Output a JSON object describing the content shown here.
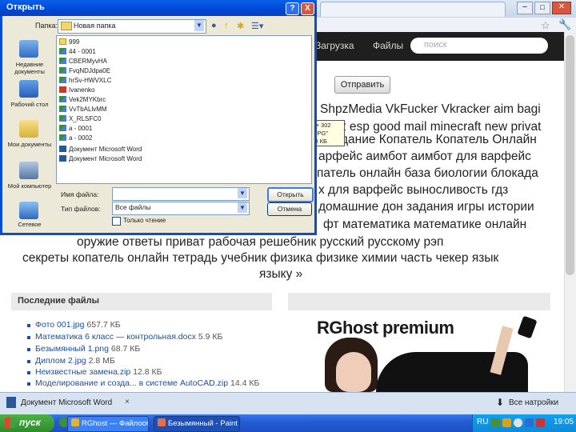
{
  "dialog": {
    "title": "Открыть",
    "look_in_label": "Папка:",
    "look_in_value": "Новая папка",
    "help_label": "?",
    "close_label": "X",
    "places": [
      {
        "label": "Недавние документы"
      },
      {
        "label": "Рабочий стол"
      },
      {
        "label": "Мои документы"
      },
      {
        "label": "Мой компьютер"
      },
      {
        "label": "Сетевое"
      }
    ],
    "files": [
      {
        "name": "999",
        "type": "folder"
      },
      {
        "name": "44 - 0001",
        "type": "image"
      },
      {
        "name": "CBERMyvHA",
        "type": "image"
      },
      {
        "name": "FvqNDJdpa0E",
        "type": "image"
      },
      {
        "name": "hrSv-HWVXLC",
        "type": "image"
      },
      {
        "name": "Ivanenko",
        "type": "pdf"
      },
      {
        "name": "Vek2MYKbrc",
        "type": "image"
      },
      {
        "name": "VvTbALlvMM",
        "type": "image"
      },
      {
        "name": "X_RLSFC0",
        "type": "image"
      },
      {
        "name": "а - 0001",
        "type": "image"
      },
      {
        "name": "а - 0002",
        "type": "image"
      },
      {
        "name": "Документ Microsoft Word",
        "type": "word"
      },
      {
        "name": "Документ Microsoft Word",
        "type": "word"
      }
    ],
    "file_name_label": "Имя файла:",
    "file_name_value": "",
    "file_type_label": "Тип файлов:",
    "file_type_value": "Все файлы",
    "read_only_label": "Только чтение",
    "open_button": "Открыть",
    "cancel_button": "Отмена"
  },
  "tooltip": {
    "line1": "Размеры: 4 × 302",
    "line2": "Тип: Файл \"JPG\"",
    "line3": "Размер: 45,3 КБ"
  },
  "site": {
    "nav_link_1": "Загрузка",
    "nav_link_2": "Файлы",
    "search_placeholder": "поиск",
    "send_button": "Отправить",
    "tagline_lines": [
      "ShpzMedia VkFucker Vkracker aim bagi",
      "2 esp good mail minecraft new privat",
      "дание Копатель Копатель Онлайн",
      "арфейс аимбот аимбот для варфейс",
      "патель онлайн база биологии блокада",
      "х для варфейс выносливость гдз",
      "домашние дон задания игры истории",
      "фт математика математике онлайн",
      "оружие ответы приват рабочая решебник русский русскому рэп",
      "секреты копатель онлайн тетрадь учебник физика физике химии часть чекер язык",
      "языку »"
    ],
    "recent_title": "Последние файлы",
    "recent_files": [
      {
        "name": "Фото 001.jpg",
        "size": "657.7 КБ"
      },
      {
        "name": "Математика 6 класс — контрольная.docx",
        "size": "5.9 КБ"
      },
      {
        "name": "Безымянный 1.png",
        "size": "68.7 КБ"
      },
      {
        "name": "Диплом 2.jpg",
        "size": "2.8 МБ"
      },
      {
        "name": "Неизвестные замена.zip",
        "size": "12.8 КБ"
      },
      {
        "name": "Моделирование и созда... в системе AutoCAD.zip",
        "size": "14.4 КБ"
      }
    ],
    "ad_title": "RGhost premium"
  },
  "app_bar": {
    "doc_label": "Документ Microsoft Word",
    "close_label": "×",
    "right_label": "Все натройки"
  },
  "taskbar": {
    "start_label": "пуск",
    "tasks": [
      {
        "label": "RGhost — Файлообмен..."
      },
      {
        "label": "Безымянный - Paint"
      }
    ],
    "lang": "RU",
    "clock": "19:05"
  },
  "colors": {
    "xp_blue": "#0048d8",
    "start_green": "#2e8c2b",
    "link_blue": "#1a4fa0",
    "site_nav": "#1f1f1f"
  }
}
